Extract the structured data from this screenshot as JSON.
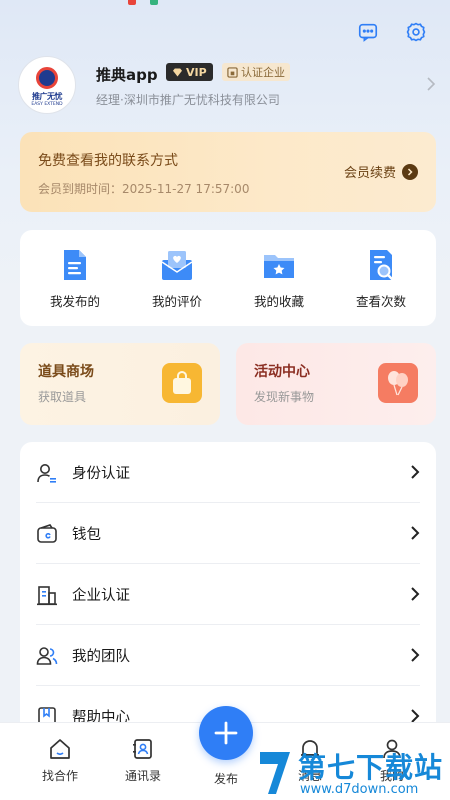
{
  "header": {
    "icons": [
      "message-icon",
      "settings-icon"
    ]
  },
  "profile": {
    "name": "推典app",
    "vip_label": "VIP",
    "cert_label": "认证企业",
    "subtitle": "经理·深圳市推广无忧科技有限公司",
    "avatar": {
      "logo_text": "推广无忧",
      "logo_sub": "EASY EXTEND"
    }
  },
  "vip_card": {
    "title": "免费查看我的联系方式",
    "expiry": "会员到期时间：2025-11-27 17:57:00",
    "renew_label": "会员续费"
  },
  "quick_actions": [
    {
      "label": "我发布的",
      "icon": "document-icon"
    },
    {
      "label": "我的评价",
      "icon": "review-envelope-icon"
    },
    {
      "label": "我的收藏",
      "icon": "star-folder-icon"
    },
    {
      "label": "查看次数",
      "icon": "search-document-icon"
    }
  ],
  "promos": {
    "tools": {
      "title": "道具商场",
      "subtitle": "获取道具",
      "icon": "shopping-bag-icon"
    },
    "events": {
      "title": "活动中心",
      "subtitle": "发现新事物",
      "icon": "balloon-icon"
    }
  },
  "menu": [
    {
      "label": "身份认证",
      "icon": "identity-icon"
    },
    {
      "label": "钱包",
      "icon": "wallet-icon"
    },
    {
      "label": "企业认证",
      "icon": "building-icon"
    },
    {
      "label": "我的团队",
      "icon": "team-icon"
    },
    {
      "label": "帮助中心",
      "icon": "help-book-icon"
    }
  ],
  "tabbar": {
    "tabs": [
      {
        "label": "找合作",
        "icon": "home-icon"
      },
      {
        "label": "通讯录",
        "icon": "contacts-icon"
      },
      {
        "label": "发布",
        "icon": "plus-icon"
      },
      {
        "label": "消息",
        "icon": "bell-icon"
      },
      {
        "label": "我的",
        "icon": "user-icon"
      }
    ]
  },
  "watermark": {
    "title": "第七下载站",
    "url": "www.d7down.com"
  },
  "colors": {
    "accent": "#2f7ef6",
    "vip_gold": "#f4d7a1",
    "background": "#eef2f7"
  }
}
